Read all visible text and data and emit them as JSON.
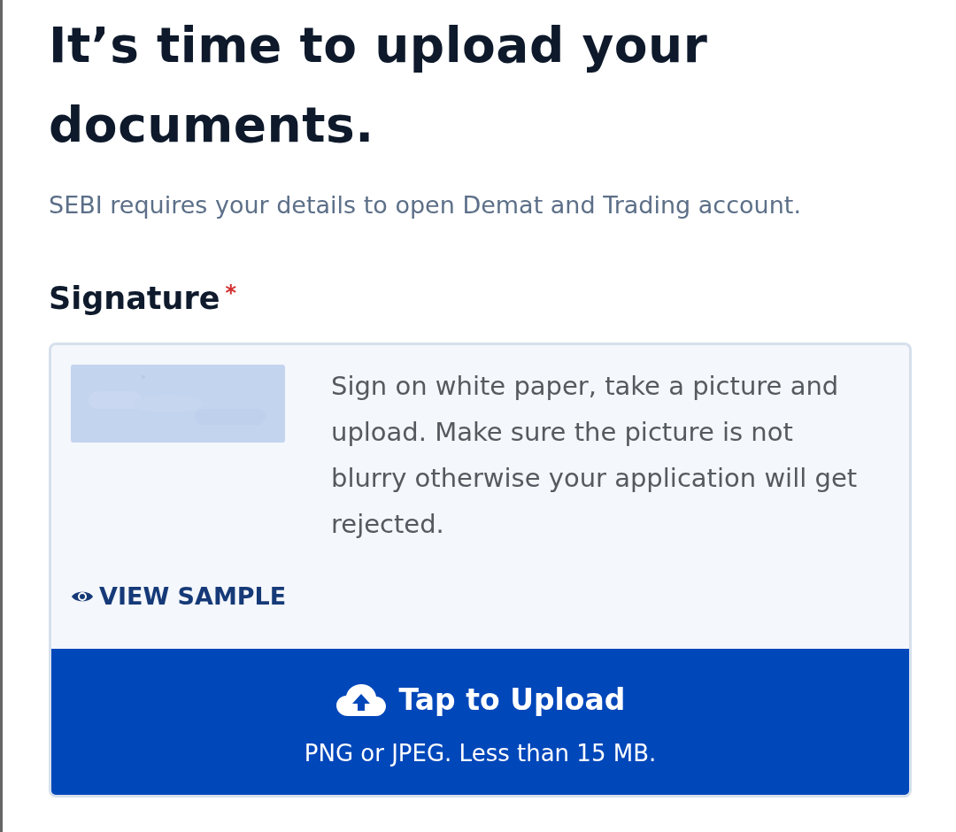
{
  "heading": "It’s time to upload your documents.",
  "subtitle": "SEBI requires your details to open Demat and Trading account.",
  "field": {
    "label": "Signature",
    "required": true,
    "required_mark": "*",
    "instructions": "Sign on white paper, take a picture and upload. Make sure the picture is not blurry otherwise your application will get rejected.",
    "view_sample": "VIEW SAMPLE",
    "upload": {
      "label": "Tap to Upload",
      "hint": "PNG or JPEG. Less than 15 MB."
    }
  }
}
